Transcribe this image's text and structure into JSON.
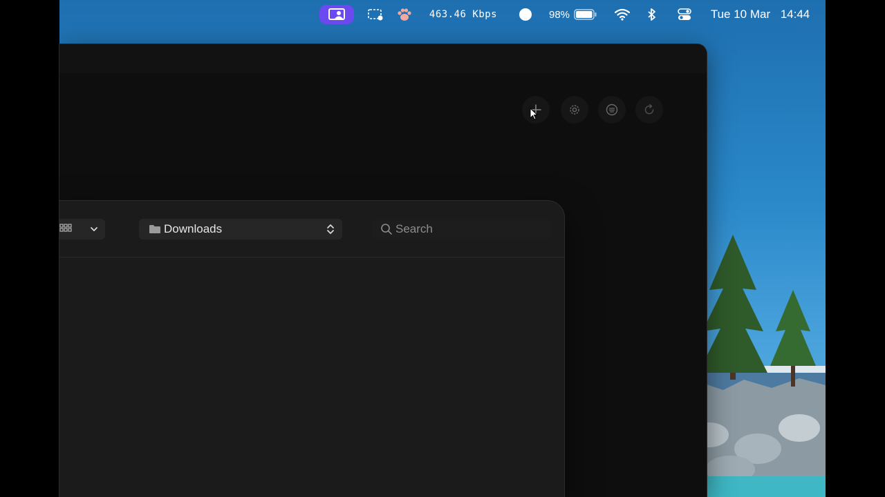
{
  "menubar": {
    "network_speed": "463.46 Kbps",
    "battery_percent": "98%",
    "battery_level": 0.98,
    "date": "Tue 10 Mar",
    "time": "14:44",
    "active_item_color": "#6b4bf0",
    "icons": [
      "screen-sharing-icon",
      "screen-record-icon",
      "paw-icon",
      "circle-status-icon",
      "battery-icon",
      "wifi-icon",
      "bluetooth-icon",
      "control-center-icon"
    ]
  },
  "main_window": {
    "toolbar_icons": [
      "plus-icon",
      "gear-icon",
      "list-circle-icon",
      "refresh-icon"
    ]
  },
  "dialog": {
    "location": "Downloads",
    "search_placeholder": "Search",
    "icons": [
      "grid-view-icon",
      "chevron-down-icon",
      "folder-icon",
      "updown-chevron-icon",
      "search-icon"
    ]
  }
}
